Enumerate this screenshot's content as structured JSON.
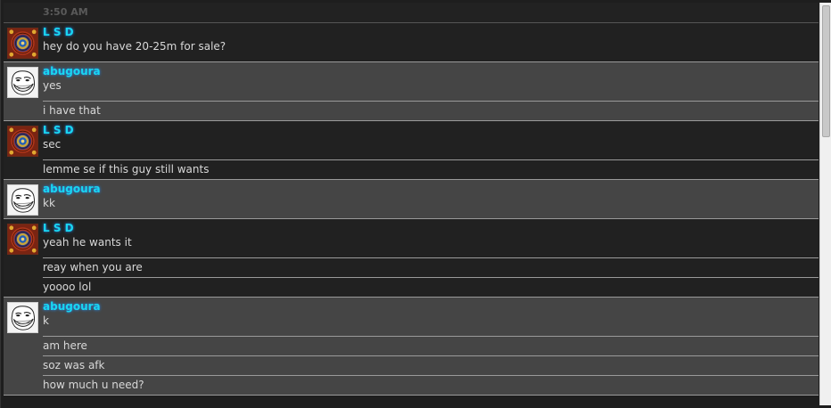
{
  "chat": {
    "timestamp": "3:50 AM",
    "groups": [
      {
        "user": "L S D",
        "avatar": "mandala-avatar-icon",
        "lines": [
          "hey do you have 20-25m for sale?"
        ]
      },
      {
        "user": "abugoura",
        "avatar": "trollface-avatar-icon",
        "lines": [
          "yes",
          "i have that"
        ]
      },
      {
        "user": "L S D",
        "avatar": "mandala-avatar-icon",
        "lines": [
          "sec",
          "lemme se if this guy still wants"
        ]
      },
      {
        "user": "abugoura",
        "avatar": "trollface-avatar-icon",
        "lines": [
          "kk"
        ]
      },
      {
        "user": "L S D",
        "avatar": "mandala-avatar-icon",
        "lines": [
          "yeah he wants it",
          "reay when you are",
          "yoooo lol"
        ]
      },
      {
        "user": "abugoura",
        "avatar": "trollface-avatar-icon",
        "lines": [
          "k",
          "am here",
          "soz was afk",
          "how much u need?"
        ]
      }
    ]
  },
  "colors": {
    "username": "#19d7f2",
    "message_text": "#d8d8d8",
    "dark_row": "#212121",
    "light_row": "#454545"
  }
}
